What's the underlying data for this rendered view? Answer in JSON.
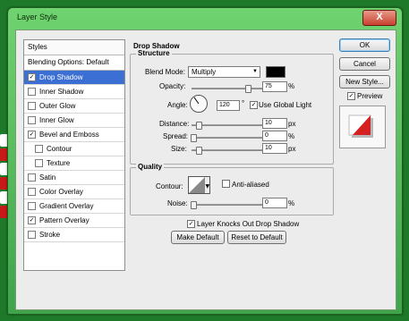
{
  "window": {
    "title": "Layer Style",
    "close_label": "X"
  },
  "sidebar": {
    "header": "Styles",
    "blending": "Blending Options: Default",
    "items": [
      {
        "label": "Drop Shadow",
        "checked": true,
        "selected": true,
        "sub": false
      },
      {
        "label": "Inner Shadow",
        "checked": false,
        "selected": false,
        "sub": false
      },
      {
        "label": "Outer Glow",
        "checked": false,
        "selected": false,
        "sub": false
      },
      {
        "label": "Inner Glow",
        "checked": false,
        "selected": false,
        "sub": false
      },
      {
        "label": "Bevel and Emboss",
        "checked": true,
        "selected": false,
        "sub": false
      },
      {
        "label": "Contour",
        "checked": false,
        "selected": false,
        "sub": true
      },
      {
        "label": "Texture",
        "checked": false,
        "selected": false,
        "sub": true
      },
      {
        "label": "Satin",
        "checked": false,
        "selected": false,
        "sub": false
      },
      {
        "label": "Color Overlay",
        "checked": false,
        "selected": false,
        "sub": false
      },
      {
        "label": "Gradient Overlay",
        "checked": false,
        "selected": false,
        "sub": false
      },
      {
        "label": "Pattern Overlay",
        "checked": true,
        "selected": false,
        "sub": false
      },
      {
        "label": "Stroke",
        "checked": false,
        "selected": false,
        "sub": false
      }
    ]
  },
  "panel": {
    "title": "Drop Shadow",
    "structure": {
      "legend": "Structure",
      "blend_mode_label": "Blend Mode:",
      "blend_mode_value": "Multiply",
      "shadow_color": "#000000",
      "opacity_label": "Opacity:",
      "opacity_value": "75",
      "opacity_unit": "%",
      "angle_label": "Angle:",
      "angle_value": "120",
      "angle_unit": "°",
      "use_global_light_label": "Use Global Light",
      "use_global_light_checked": true,
      "distance_label": "Distance:",
      "distance_value": "10",
      "distance_unit": "px",
      "spread_label": "Spread:",
      "spread_value": "0",
      "spread_unit": "%",
      "size_label": "Size:",
      "size_value": "10",
      "size_unit": "px"
    },
    "quality": {
      "legend": "Quality",
      "contour_label": "Contour:",
      "anti_aliased_label": "Anti-aliased",
      "anti_aliased_checked": false,
      "noise_label": "Noise:",
      "noise_value": "0",
      "noise_unit": "%"
    },
    "knockout_label": "Layer Knocks Out Drop Shadow",
    "knockout_checked": true,
    "make_default_label": "Make Default",
    "reset_default_label": "Reset to Default"
  },
  "right": {
    "ok_label": "OK",
    "cancel_label": "Cancel",
    "new_style_label": "New Style...",
    "preview_label": "Preview",
    "preview_checked": true
  },
  "colors": {
    "selection": "#3b6fd3",
    "window_frame": "#3fa44a",
    "accent_red": "#d42020"
  }
}
